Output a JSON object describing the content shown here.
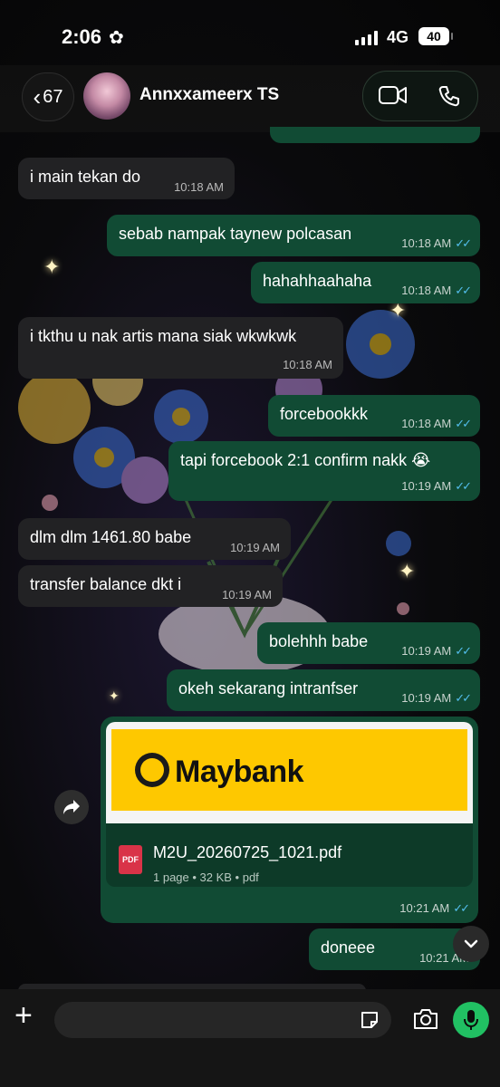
{
  "status": {
    "time": "2:06",
    "network": "4G",
    "battery": "40"
  },
  "header": {
    "back_count": "67",
    "contact_name": "Annxxameerx TS"
  },
  "messages": [
    {
      "dir": "in",
      "text": "i main tekan do",
      "time": "10:18 AM"
    },
    {
      "dir": "out",
      "text": "sebab nampak taynew polcasan",
      "time": "10:18 AM"
    },
    {
      "dir": "out",
      "text": "hahahhaahaha",
      "time": "10:18 AM"
    },
    {
      "dir": "in",
      "text": "i tkthu u nak artis mana siak wkwkwk",
      "time": "10:18 AM"
    },
    {
      "dir": "out",
      "text": "forcebookkk",
      "time": "10:18 AM"
    },
    {
      "dir": "out",
      "text": "tapi forcebook 2:1 confirm nakk 😭",
      "time": "10:19 AM"
    },
    {
      "dir": "in",
      "text": "dlm dlm 1461.80 babe",
      "time": "10:19 AM"
    },
    {
      "dir": "in",
      "text": "transfer balance dkt i",
      "time": "10:19 AM"
    },
    {
      "dir": "out",
      "text": "bolehhh babe",
      "time": "10:19 AM"
    },
    {
      "dir": "out",
      "text": "okeh sekarang intranfser",
      "time": "10:19 AM"
    },
    {
      "dir": "out",
      "text": "doneee",
      "time": "10:21 AM"
    }
  ],
  "document": {
    "brand": "Maybank",
    "icon_label": "PDF",
    "file_name": "M2U_20260725_1021.pdf",
    "meta": "1 page • 32 KB • pdf",
    "time": "10:21 AM"
  },
  "input": {
    "placeholder": ""
  },
  "colors": {
    "outgoing": "#114b34",
    "incoming": "#222224",
    "read_ticks": "#53bdeb",
    "mic": "#21c063"
  }
}
